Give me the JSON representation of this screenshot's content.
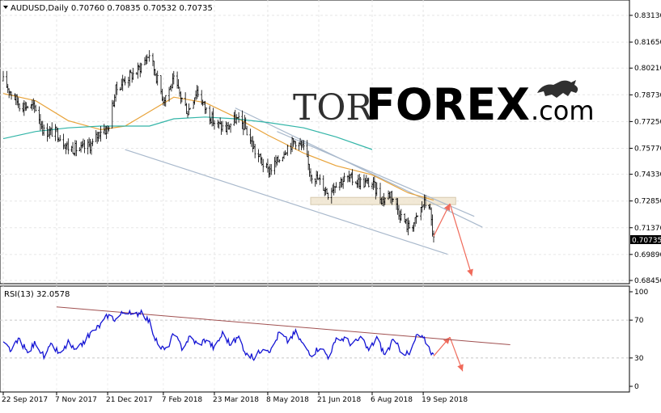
{
  "header": {
    "symbol_line": "AUDUSD,Daily  0.70760 0.70835 0.70532 0.70735"
  },
  "logo": {
    "part1": "TOR",
    "part2": "FOREX",
    "part3": ".com"
  },
  "colors": {
    "candle": "#000000",
    "ma_fast": "#e8a33a",
    "ma_slow": "#33b5a8",
    "channel": "#a9b9cc",
    "resistance_zone": "#f0e6d0",
    "forecast_arrow": "#f06a5a",
    "rsi_line": "#1414d4",
    "rsi_trendline": "#a05050",
    "price_label_bg": "#000000",
    "logo_dark": "#303030",
    "logo_accent": "#ff5a1a"
  },
  "chart_data": [
    {
      "type": "candlestick",
      "title": "AUDUSD,Daily",
      "ohlc_last": {
        "open": 0.7076,
        "high": 0.70835,
        "low": 0.70532,
        "close": 0.70735
      },
      "current_price_label": "0.70735",
      "ylim": [
        0.6845,
        0.8313
      ],
      "y_ticks": [
        "0.83130",
        "0.81650",
        "0.80210",
        "0.78730",
        "0.77250",
        "0.75770",
        "0.74330",
        "0.72850",
        "0.71370",
        "0.69890",
        "0.68450"
      ],
      "x_ticks": [
        "22 Sep 2017",
        "7 Nov 2017",
        "21 Dec 2017",
        "7 Feb 2018",
        "23 Mar 2018",
        "8 May 2018",
        "21 Jun 2018",
        "6 Aug 2018",
        "19 Sep 2018"
      ],
      "close_path": [
        [
          "2017-09-22",
          0.795
        ],
        [
          "2017-10-06",
          0.782
        ],
        [
          "2017-10-20",
          0.78
        ],
        [
          "2017-10-27",
          0.767
        ],
        [
          "2017-11-07",
          0.7665
        ],
        [
          "2017-11-17",
          0.758
        ],
        [
          "2017-11-28",
          0.757
        ],
        [
          "2017-12-08",
          0.76
        ],
        [
          "2017-12-15",
          0.768
        ],
        [
          "2017-12-21",
          0.768
        ],
        [
          "2017-12-28",
          0.79
        ],
        [
          "2018-01-05",
          0.796
        ],
        [
          "2018-01-15",
          0.8
        ],
        [
          "2018-01-26",
          0.81
        ],
        [
          "2018-02-07",
          0.785
        ],
        [
          "2018-02-16",
          0.795
        ],
        [
          "2018-02-28",
          0.778
        ],
        [
          "2018-03-08",
          0.79
        ],
        [
          "2018-03-15",
          0.78
        ],
        [
          "2018-03-23",
          0.772
        ],
        [
          "2018-04-02",
          0.768
        ],
        [
          "2018-04-10",
          0.774
        ],
        [
          "2018-04-18",
          0.77
        ],
        [
          "2018-04-27",
          0.756
        ],
        [
          "2018-05-08",
          0.745
        ],
        [
          "2018-05-16",
          0.75
        ],
        [
          "2018-05-24",
          0.758
        ],
        [
          "2018-06-01",
          0.762
        ],
        [
          "2018-06-08",
          0.757
        ],
        [
          "2018-06-14",
          0.744
        ],
        [
          "2018-06-21",
          0.74
        ],
        [
          "2018-06-29",
          0.733
        ],
        [
          "2018-07-06",
          0.739
        ],
        [
          "2018-07-16",
          0.741
        ],
        [
          "2018-07-27",
          0.739
        ],
        [
          "2018-08-06",
          0.738
        ],
        [
          "2018-08-15",
          0.729
        ],
        [
          "2018-08-22",
          0.733
        ],
        [
          "2018-08-31",
          0.72
        ],
        [
          "2018-09-06",
          0.714
        ],
        [
          "2018-09-12",
          0.717
        ],
        [
          "2018-09-19",
          0.727
        ],
        [
          "2018-09-24",
          0.727
        ],
        [
          "2018-09-28",
          0.707
        ]
      ],
      "ma_fast_path": [
        [
          "2017-09-22",
          0.788
        ],
        [
          "2017-10-20",
          0.784
        ],
        [
          "2017-11-17",
          0.773
        ],
        [
          "2017-12-15",
          0.768
        ],
        [
          "2018-01-05",
          0.77
        ],
        [
          "2018-01-26",
          0.778
        ],
        [
          "2018-02-16",
          0.786
        ],
        [
          "2018-03-15",
          0.783
        ],
        [
          "2018-04-10",
          0.775
        ],
        [
          "2018-05-08",
          0.765
        ],
        [
          "2018-06-08",
          0.755
        ],
        [
          "2018-07-06",
          0.748
        ],
        [
          "2018-08-06",
          0.743
        ],
        [
          "2018-09-06",
          0.733
        ],
        [
          "2018-09-28",
          0.729
        ]
      ],
      "ma_slow_path": [
        [
          "2017-09-22",
          0.763
        ],
        [
          "2017-10-20",
          0.767
        ],
        [
          "2017-11-17",
          0.769
        ],
        [
          "2017-12-15",
          0.77
        ],
        [
          "2018-01-26",
          0.77
        ],
        [
          "2018-02-16",
          0.774
        ],
        [
          "2018-03-15",
          0.775
        ],
        [
          "2018-04-10",
          0.774
        ],
        [
          "2018-05-08",
          0.772
        ],
        [
          "2018-06-08",
          0.769
        ],
        [
          "2018-07-06",
          0.764
        ],
        [
          "2018-08-06",
          0.757
        ]
      ],
      "channel_upper": [
        [
          "2018-04-10",
          0.78
        ],
        [
          "2018-11-09",
          0.714
        ]
      ],
      "channel_middle": [
        [
          "2018-05-16",
          0.767
        ],
        [
          "2018-11-02",
          0.72
        ]
      ],
      "channel_lower": [
        [
          "2018-01-05",
          0.757
        ],
        [
          "2018-10-10",
          0.699
        ]
      ],
      "resistance_zone": {
        "from": "2018-06-14",
        "to": "2018-10-17",
        "y_low": 0.7265,
        "y_high": 0.7305
      },
      "forecast_path": [
        [
          "2018-09-28",
          0.709
        ],
        [
          "2018-10-12",
          0.727
        ],
        [
          "2018-10-31",
          0.687
        ]
      ]
    },
    {
      "type": "line",
      "title": "RSI(13) 32.0578",
      "ylim": [
        0,
        100
      ],
      "y_ticks": [
        "100",
        "70",
        "30",
        "0"
      ],
      "levels": [
        70,
        30
      ],
      "rsi_path": [
        [
          "2017-09-22",
          45
        ],
        [
          "2017-09-29",
          38
        ],
        [
          "2017-10-06",
          50
        ],
        [
          "2017-10-13",
          35
        ],
        [
          "2017-10-20",
          47
        ],
        [
          "2017-10-27",
          31
        ],
        [
          "2017-11-03",
          44
        ],
        [
          "2017-11-10",
          33
        ],
        [
          "2017-11-17",
          46
        ],
        [
          "2017-11-24",
          36
        ],
        [
          "2017-12-01",
          48
        ],
        [
          "2017-12-08",
          58
        ],
        [
          "2017-12-15",
          65
        ],
        [
          "2017-12-21",
          75
        ],
        [
          "2017-12-28",
          71
        ],
        [
          "2018-01-05",
          80
        ],
        [
          "2018-01-12",
          74
        ],
        [
          "2018-01-19",
          80
        ],
        [
          "2018-01-26",
          68
        ],
        [
          "2018-02-02",
          44
        ],
        [
          "2018-02-09",
          38
        ],
        [
          "2018-02-16",
          55
        ],
        [
          "2018-02-23",
          41
        ],
        [
          "2018-03-02",
          52
        ],
        [
          "2018-03-09",
          44
        ],
        [
          "2018-03-16",
          50
        ],
        [
          "2018-03-23",
          40
        ],
        [
          "2018-03-30",
          56
        ],
        [
          "2018-04-06",
          44
        ],
        [
          "2018-04-13",
          52
        ],
        [
          "2018-04-20",
          33
        ],
        [
          "2018-04-27",
          30
        ],
        [
          "2018-05-04",
          42
        ],
        [
          "2018-05-11",
          38
        ],
        [
          "2018-05-18",
          57
        ],
        [
          "2018-05-25",
          48
        ],
        [
          "2018-06-01",
          57
        ],
        [
          "2018-06-08",
          43
        ],
        [
          "2018-06-15",
          34
        ],
        [
          "2018-06-22",
          42
        ],
        [
          "2018-06-29",
          32
        ],
        [
          "2018-07-06",
          48
        ],
        [
          "2018-07-13",
          51
        ],
        [
          "2018-07-20",
          44
        ],
        [
          "2018-07-27",
          51
        ],
        [
          "2018-08-03",
          38
        ],
        [
          "2018-08-10",
          51
        ],
        [
          "2018-08-17",
          33
        ],
        [
          "2018-08-24",
          48
        ],
        [
          "2018-08-31",
          38
        ],
        [
          "2018-09-07",
          33
        ],
        [
          "2018-09-14",
          55
        ],
        [
          "2018-09-21",
          48
        ],
        [
          "2018-09-28",
          32
        ]
      ],
      "rsi_trendline": [
        [
          "2017-11-07",
          84
        ],
        [
          "2018-12-03",
          44
        ]
      ],
      "forecast_path": [
        [
          "2018-09-28",
          32
        ],
        [
          "2018-10-12",
          52
        ],
        [
          "2018-10-23",
          16
        ]
      ]
    }
  ]
}
